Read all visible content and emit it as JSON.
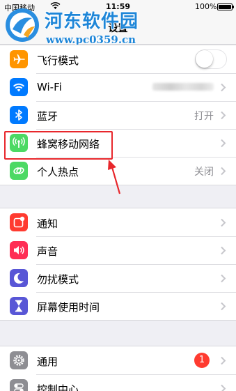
{
  "status_bar": {
    "carrier": "中国移动",
    "time": "11:59",
    "battery": "100%"
  },
  "nav": {
    "title": "设置"
  },
  "watermark": {
    "title": "河东软件园",
    "url": "www.pc0359.cn"
  },
  "colors": {
    "airplane": "#ff9500",
    "wifi": "#007aff",
    "bluetooth": "#007aff",
    "cellular": "#4cd964",
    "hotspot": "#4cd964",
    "notifications": "#ff3b30",
    "sounds": "#ff2d55",
    "dnd": "#5856d6",
    "screen_time": "#5856d6",
    "general": "#8e8e93",
    "control_center": "#8e8e93",
    "highlight": "#e8272c"
  },
  "group1": [
    {
      "label": "飞行模式",
      "icon": "airplane-icon",
      "control": "toggle",
      "toggle_on": false
    },
    {
      "label": "Wi-Fi",
      "icon": "wifi-icon",
      "value": ""
    },
    {
      "label": "蓝牙",
      "icon": "bluetooth-icon",
      "value": "打开"
    },
    {
      "label": "蜂窝移动网络",
      "icon": "cellular-icon",
      "value": ""
    },
    {
      "label": "个人热点",
      "icon": "hotspot-icon",
      "value": "关闭"
    }
  ],
  "group2": [
    {
      "label": "通知",
      "icon": "notifications-icon"
    },
    {
      "label": "声音",
      "icon": "sounds-icon"
    },
    {
      "label": "勿扰模式",
      "icon": "moon-icon"
    },
    {
      "label": "屏幕使用时间",
      "icon": "hourglass-icon"
    }
  ],
  "group3": [
    {
      "label": "通用",
      "icon": "gear-icon",
      "badge": "1"
    },
    {
      "label": "控制中心",
      "icon": "switches-icon"
    }
  ]
}
